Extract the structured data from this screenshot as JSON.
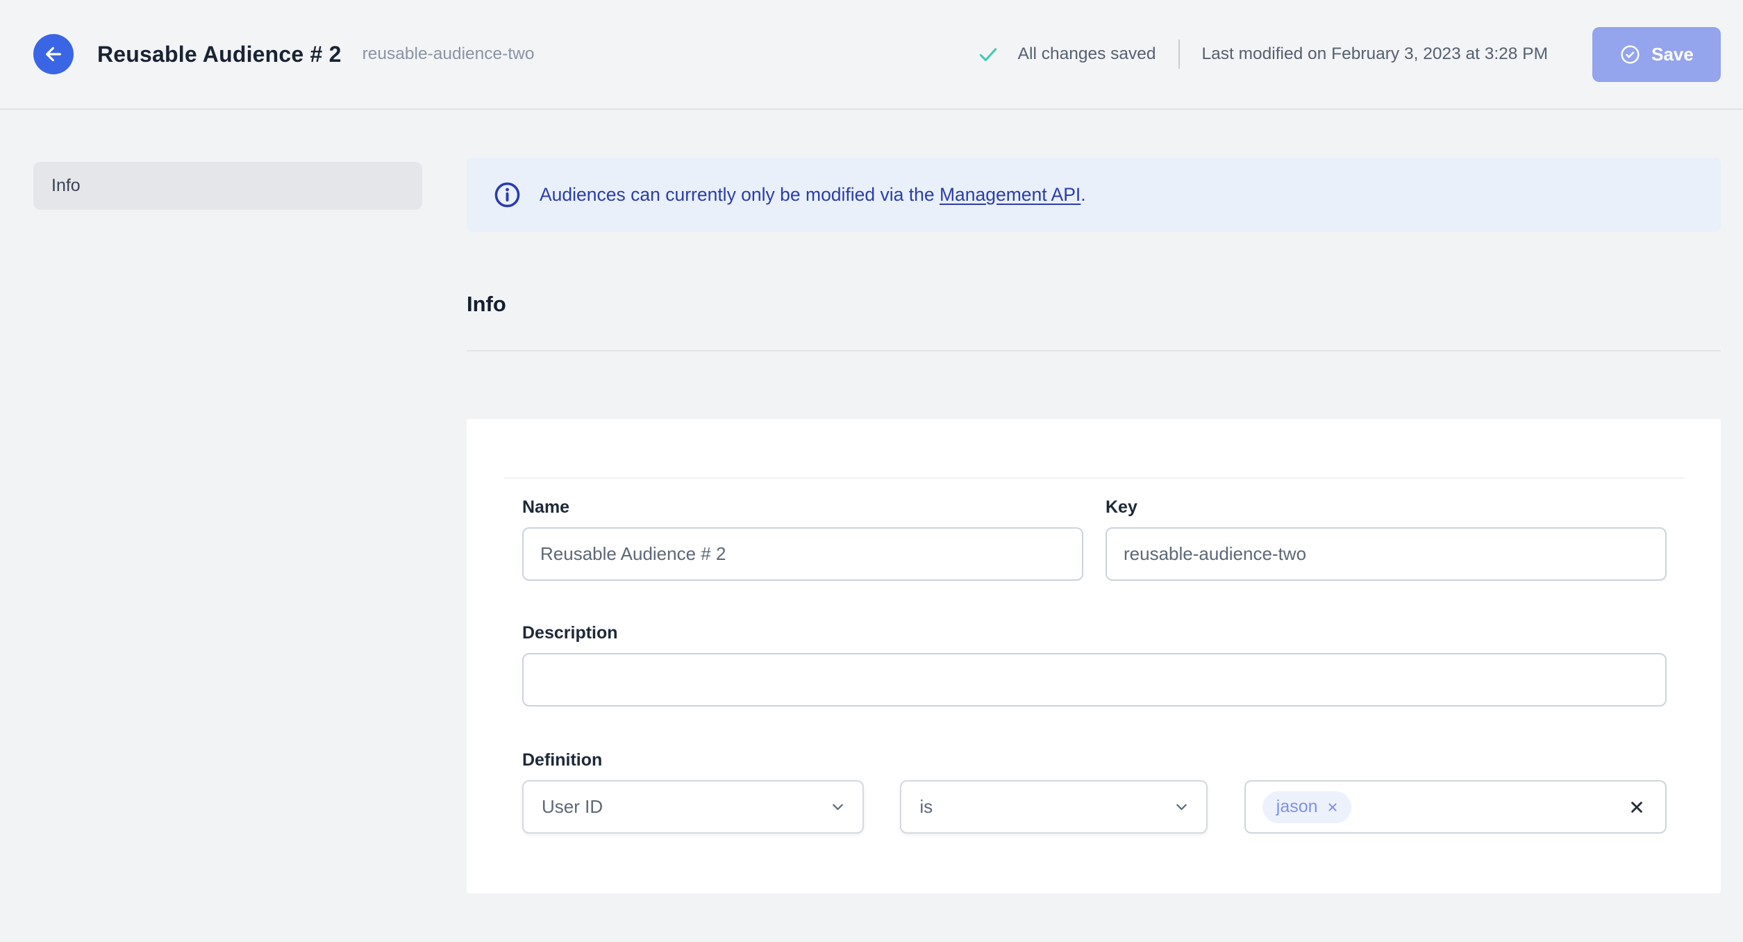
{
  "header": {
    "title": "Reusable Audience # 2",
    "subtitle": "reusable-audience-two",
    "status_text": "All changes saved",
    "last_modified": "Last modified on February 3, 2023 at 3:28 PM",
    "save_label": "Save",
    "icons": {
      "back": "arrow-left-icon",
      "status": "check-icon",
      "save": "check-circle-icon"
    }
  },
  "sidebar": {
    "items": [
      {
        "label": "Info",
        "active": true
      }
    ]
  },
  "banner": {
    "icon": "info-icon",
    "text_before": "Audiences can currently only be modified via the ",
    "link_text": "Management API",
    "text_after": "."
  },
  "section": {
    "title": "Info"
  },
  "form": {
    "name": {
      "label": "Name",
      "value": "Reusable Audience # 2"
    },
    "key": {
      "label": "Key",
      "value": "reusable-audience-two"
    },
    "description": {
      "label": "Description",
      "value": ""
    },
    "definition": {
      "label": "Definition",
      "property": "User ID",
      "operator": "is",
      "values": [
        "jason"
      ]
    }
  },
  "colors": {
    "accent_blue": "#3a65e5",
    "save_button_bg": "#94a4ed",
    "banner_bg": "#e9f0fa",
    "banner_text": "#2b3cae",
    "success_check": "#41ccb4",
    "chip_bg": "#edf1fc",
    "chip_text": "#7d90ee",
    "page_bg": "#f2f3f5"
  }
}
